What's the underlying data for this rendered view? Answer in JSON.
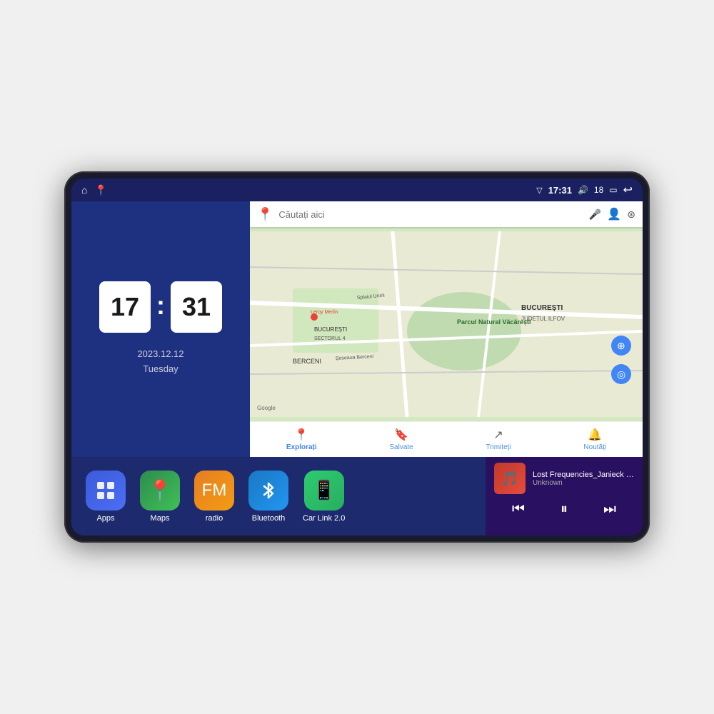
{
  "device": {
    "screen": {
      "status_bar": {
        "left_icons": [
          "home",
          "location"
        ],
        "time": "17:31",
        "signal": "▽",
        "volume": "🔊",
        "battery_level": "18",
        "battery_icon": "🔋",
        "back": "↩"
      },
      "clock": {
        "hours": "17",
        "minutes": "31"
      },
      "date": {
        "line1": "2023.12.12",
        "line2": "Tuesday"
      },
      "map": {
        "search_placeholder": "Căutați aici",
        "bottom_items": [
          {
            "icon": "📍",
            "label": "Explorați",
            "active": true
          },
          {
            "icon": "🔖",
            "label": "Salvate",
            "active": false
          },
          {
            "icon": "↗",
            "label": "Trimiteți",
            "active": false
          },
          {
            "icon": "🔔",
            "label": "Noutăți",
            "active": false
          }
        ]
      },
      "apps": [
        {
          "id": "apps",
          "label": "Apps",
          "icon": "⊞",
          "color_class": "app-apps"
        },
        {
          "id": "maps",
          "label": "Maps",
          "icon": "📍",
          "color_class": "app-maps"
        },
        {
          "id": "radio",
          "label": "radio",
          "icon": "📻",
          "color_class": "app-radio"
        },
        {
          "id": "bluetooth",
          "label": "Bluetooth",
          "icon": "⬡",
          "color_class": "app-bluetooth"
        },
        {
          "id": "carlink",
          "label": "Car Link 2.0",
          "icon": "📱",
          "color_class": "app-carlink"
        }
      ],
      "music": {
        "title": "Lost Frequencies_Janieck Devy-...",
        "artist": "Unknown",
        "controls": {
          "prev": "⏮",
          "play_pause": "⏸",
          "next": "⏭"
        }
      }
    }
  }
}
